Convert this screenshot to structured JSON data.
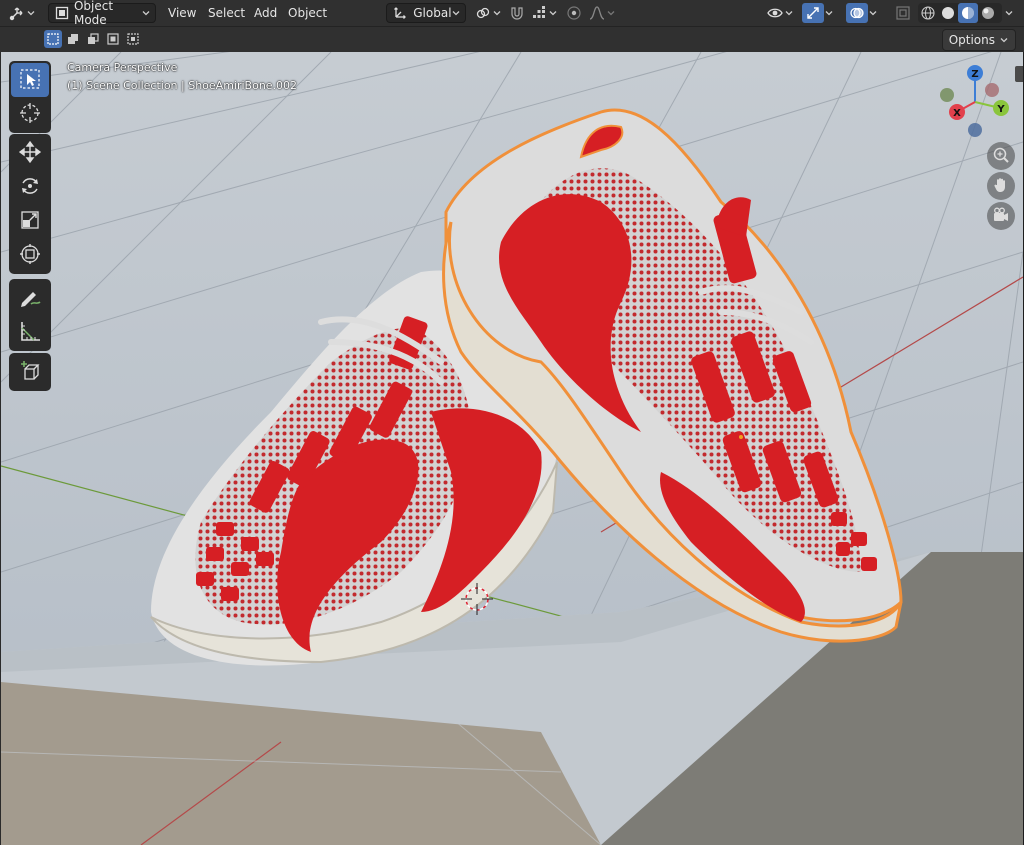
{
  "header": {
    "mode_label": "Object Mode",
    "menus": [
      "View",
      "Select",
      "Add",
      "Object"
    ],
    "transform_orientation": "Global"
  },
  "subbar": {
    "options_label": "Options"
  },
  "viewport": {
    "view_name": "Camera Perspective",
    "collection_info": "(1) Scene Collection | ShoeAmiriBone.002"
  },
  "gizmo": {
    "x_label": "X",
    "y_label": "Y",
    "z_label": "Z"
  },
  "colors": {
    "accent": "#4772b3",
    "header_bg": "#303030",
    "shoe_red": "#d61f24",
    "selection_outline": "#f0903a",
    "axis_x": "#e2404c",
    "axis_y": "#8ac53c",
    "axis_z": "#3d7ed6"
  },
  "icons": {
    "editor_type": "editor-type-icon",
    "object_mode": "object-mode-icon",
    "orientation": "transform-orientation-icon",
    "pivot": "pivot-point-icon",
    "snap": "snap-magnet-icon",
    "proportional": "proportional-edit-icon",
    "falloff": "falloff-curve-icon",
    "visibility": "eye-icon",
    "gizmos": "gizmo-icon",
    "overlays": "overlays-icon",
    "xray": "xray-icon",
    "shading_wire": "shading-wireframe-icon",
    "shading_solid": "shading-solid-icon",
    "shading_material": "shading-material-icon",
    "shading_rendered": "shading-rendered-icon",
    "zoom": "zoom-icon",
    "hand": "hand-pan-icon",
    "camera": "camera-icon"
  }
}
